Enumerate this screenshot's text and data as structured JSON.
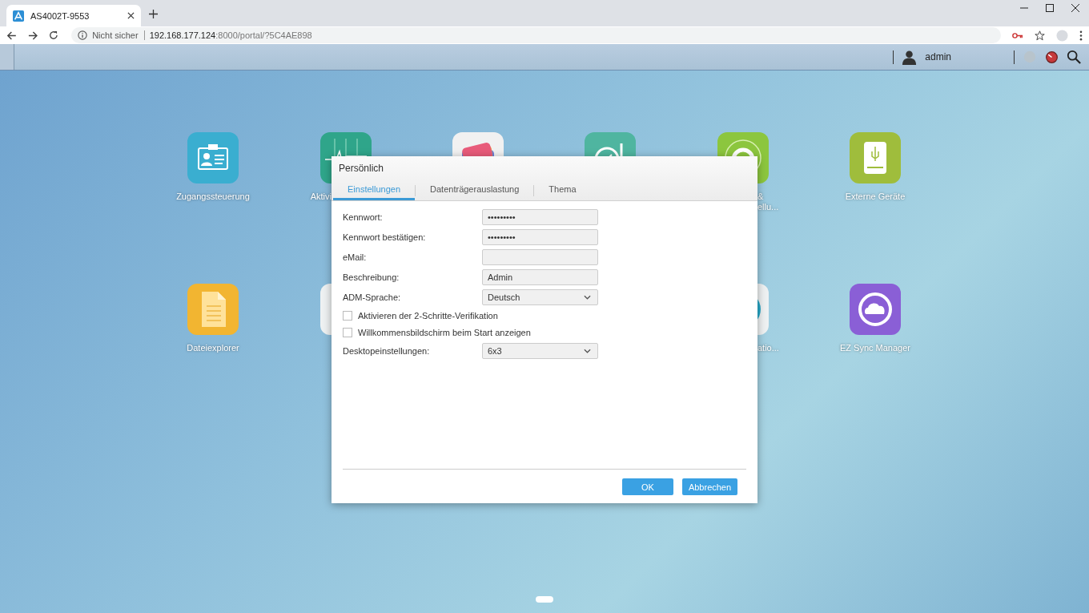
{
  "browser": {
    "tab": {
      "title": "AS4002T-9553"
    },
    "address": {
      "security": "Nicht sicher",
      "host": "192.168.177.124",
      "path": ":8000/portal/?5C4AE898"
    }
  },
  "topbar": {
    "user": "admin"
  },
  "desktop": [
    {
      "kind": "access",
      "label_lines": [
        "Zugangssteuerung"
      ]
    },
    {
      "kind": "monitor",
      "label_lines": [
        "Aktivi"
      ]
    },
    {
      "kind": "photos"
    },
    {
      "kind": "compass"
    },
    {
      "kind": "target",
      "label_lines": [
        "&",
        "ellu..."
      ]
    },
    {
      "kind": "drive",
      "label_lines": [
        "Externe Geräte"
      ]
    },
    {
      "kind": "file",
      "label_lines": [
        "Dateiexplorer"
      ]
    },
    {
      "kind": "plain"
    },
    {
      "kind": "disc",
      "label_lines": [
        "atio..."
      ]
    },
    {
      "kind": "sync",
      "label_lines": [
        "EZ Sync Manager"
      ]
    }
  ],
  "dialog": {
    "title": "Persönlich",
    "tabs": [
      {
        "label": "Einstellungen",
        "selected": true
      },
      {
        "label": "Datenträgerauslastung",
        "selected": false
      },
      {
        "label": "Thema",
        "selected": false
      }
    ],
    "fields": [
      {
        "kind": "text",
        "label": "Kennwort:",
        "value": "•••••••••"
      },
      {
        "kind": "text",
        "label": "Kennwort bestätigen:",
        "value": "•••••••••"
      },
      {
        "kind": "text",
        "label": "eMail:"
      },
      {
        "kind": "text",
        "label": "Beschreibung:",
        "value": "Admin"
      },
      {
        "kind": "select",
        "label": "ADM-Sprache:",
        "value": "Deutsch"
      },
      {
        "kind": "checkbox",
        "label": "Aktivieren der 2-Schritte-Verifikation",
        "checked": false
      },
      {
        "kind": "checkbox",
        "label": "Willkommensbildschirm beim Start anzeigen",
        "checked": false
      },
      {
        "kind": "select",
        "label": "Desktopeinstellungen:",
        "value": "6x3"
      }
    ],
    "buttons": [
      "OK",
      "Abbrechen"
    ]
  }
}
